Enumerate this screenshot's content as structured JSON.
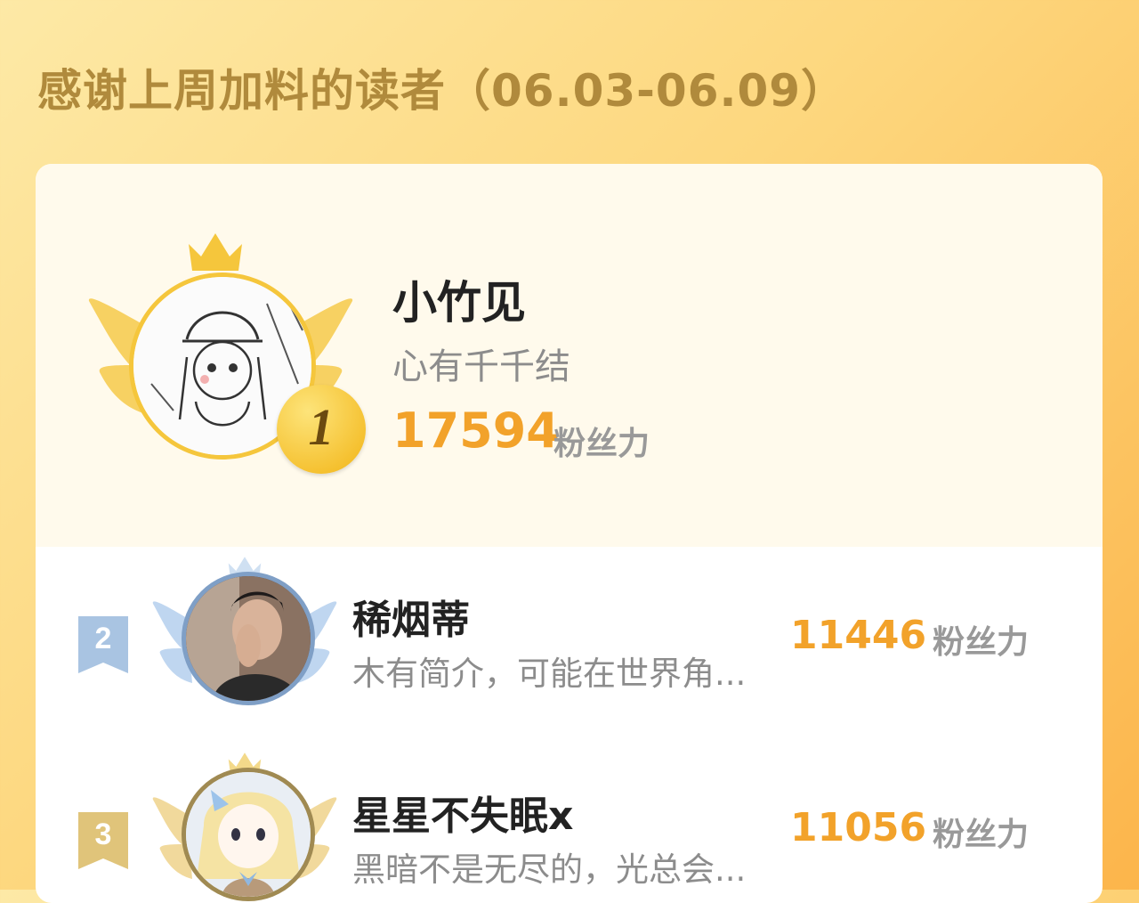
{
  "header": {
    "title": "感谢上周加料的读者（06.03-06.09）"
  },
  "unit_label": "粉丝力",
  "first_place": {
    "rank": "1",
    "name": "小竹见",
    "bio": "心有千千结",
    "score": "17594"
  },
  "ranking": [
    {
      "rank": "2",
      "name": "稀烟蒂",
      "bio": "木有简介，可能在世界角...",
      "score": "11446"
    },
    {
      "rank": "3",
      "name": "星星不失眠x",
      "bio": "黑暗不是无尽的，光总会...",
      "score": "11056"
    }
  ],
  "colors": {
    "background_start": "#fde9a6",
    "background_end": "#fcb54b",
    "title": "#b08a3c",
    "score": "#f2a22a",
    "gold": "#f5c63c",
    "silver": "#a9c4e2",
    "bronze": "#e0c47a"
  },
  "icons": [
    "crown-icon",
    "wings-icon",
    "rank-medal-icon",
    "rank-ribbon-icon"
  ]
}
